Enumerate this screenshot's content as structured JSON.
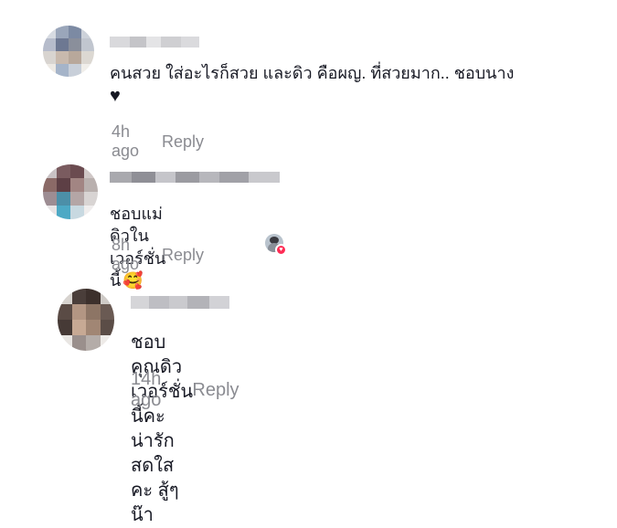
{
  "comments": [
    {
      "text": "คนสวย ใส่อะไรก็สวย และดิว คือผญ. ที่สวยมาก.. ชอบนาง",
      "emoji": "♥",
      "time": "4h ago",
      "reply_label": "Reply"
    },
    {
      "text": "ชอบแม่ดิวในเวอร์ชั่นนี้",
      "emoji": "🥰",
      "time": "8h ago",
      "reply_label": "Reply"
    },
    {
      "text": "ชอบคุณดิวเวอร์ชั่นนี้คะ น่ารักสดใสคะ สู้ๆน๊า",
      "time": "14h ago",
      "reply_label": "Reply"
    }
  ],
  "colors": {
    "text": "#161823",
    "meta": "#8a8b91",
    "background": "#ffffff"
  }
}
